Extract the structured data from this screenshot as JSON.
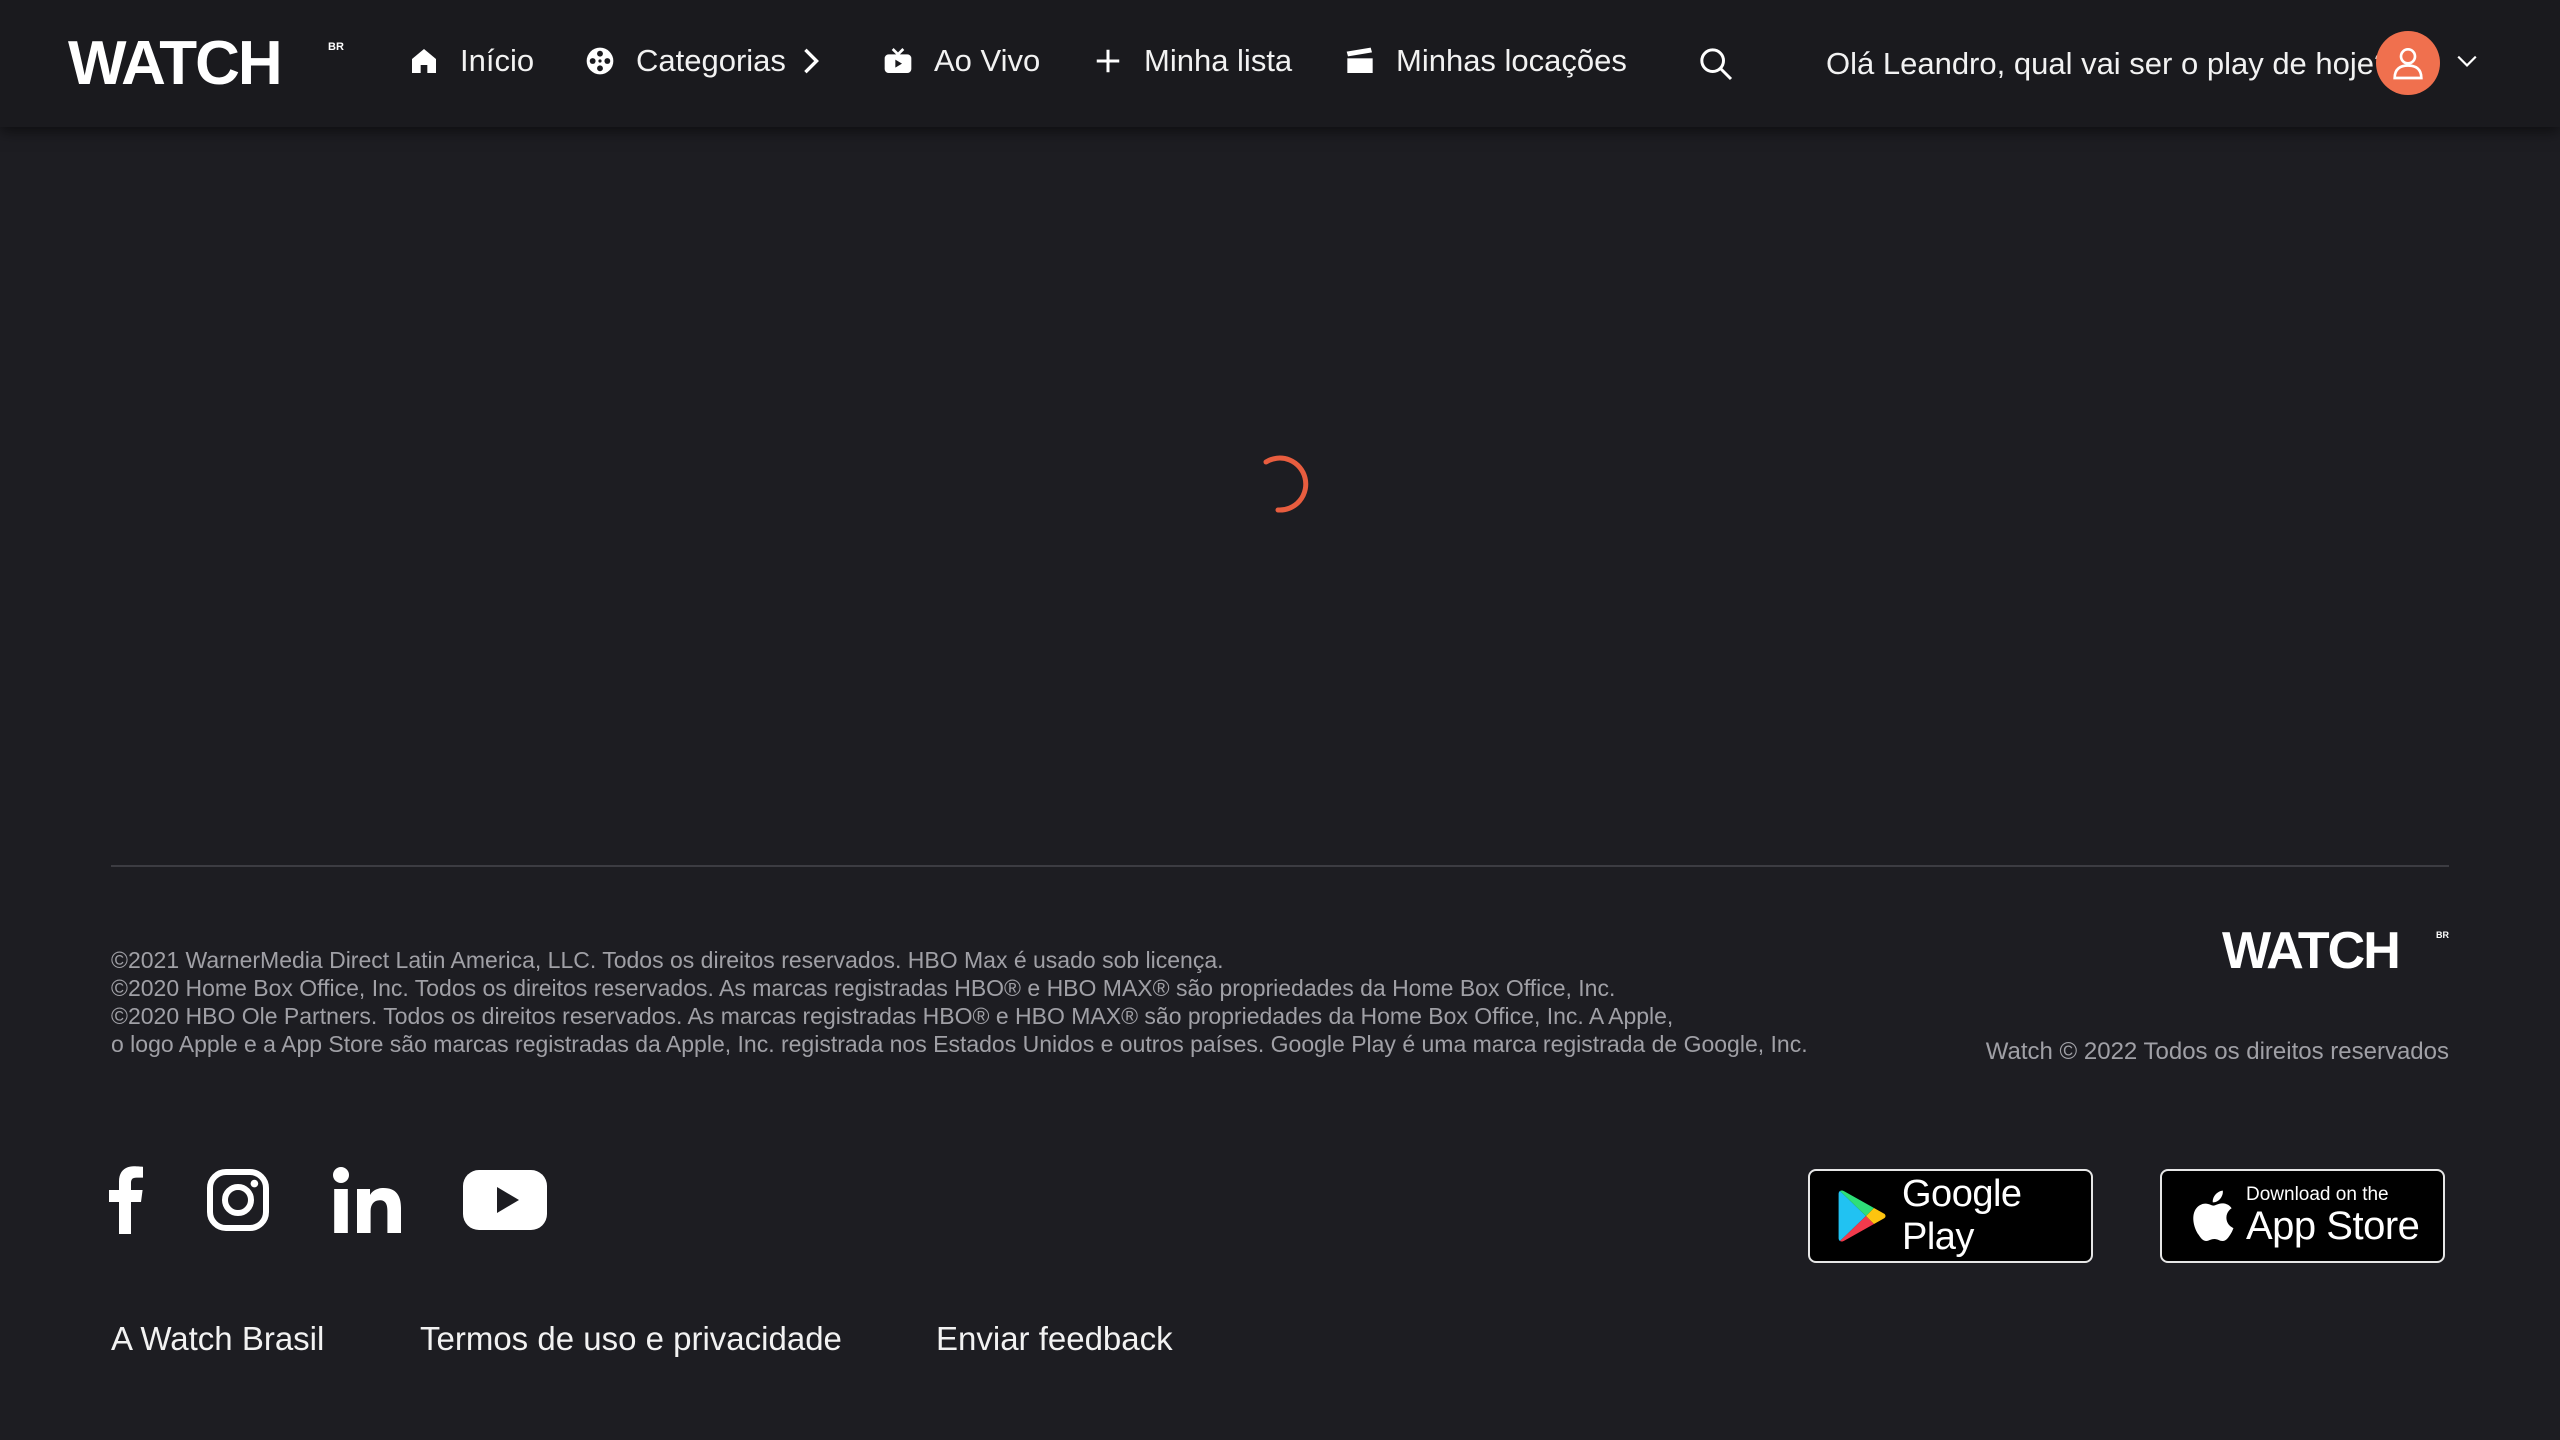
{
  "header": {
    "logo_text": "WATCH",
    "logo_suffix": "BR",
    "nav": [
      {
        "label": "Início",
        "icon": "home-icon"
      },
      {
        "label": "Categorias",
        "icon": "film-reel-icon"
      },
      {
        "label": "Ao Vivo",
        "icon": "live-tv-icon"
      },
      {
        "label": "Minha lista",
        "icon": "plus-icon"
      },
      {
        "label": "Minhas locações",
        "icon": "clapperboard-icon"
      }
    ],
    "search_icon": "search-icon",
    "greeting": "Olá Leandro, qual vai ser o play de hoje?",
    "avatar_icon": "user-icon",
    "accent_color": "#f0704e"
  },
  "main": {
    "loading_spinner_color": "#e85d3f"
  },
  "footer": {
    "legal_lines": [
      "©2021 WarnerMedia Direct Latin America, LLC. Todos os direitos reservados. HBO Max é usado sob licença.",
      "©2020 Home Box Office, Inc. Todos os direitos reservados. As marcas registradas HBO® e HBO MAX® são propriedades da Home Box Office, Inc.",
      "©2020 HBO Ole Partners. Todos os direitos reservados. As marcas registradas HBO® e HBO MAX® são propriedades da Home Box Office, Inc. A Apple,",
      "o logo Apple e a App Store são marcas registradas da Apple, Inc. registrada nos Estados Unidos e outros países. Google Play é uma marca registrada de Google, Inc."
    ],
    "logo_text": "WATCH",
    "logo_suffix": "BR",
    "rights": "Watch © 2022 Todos os direitos reservados",
    "social": [
      {
        "name": "facebook-icon"
      },
      {
        "name": "instagram-icon"
      },
      {
        "name": "linkedin-icon"
      },
      {
        "name": "youtube-icon"
      }
    ],
    "google_play": {
      "label": "Google Play"
    },
    "app_store": {
      "small": "Download on the",
      "big": "App Store"
    },
    "links": [
      "A Watch Brasil",
      "Termos de uso e privacidade",
      "Enviar feedback"
    ]
  }
}
